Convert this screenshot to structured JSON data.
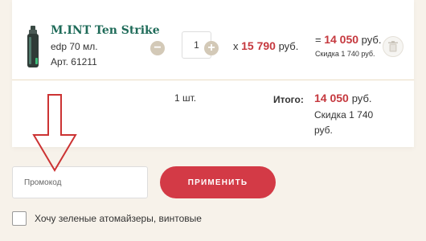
{
  "product": {
    "title": "M.INT Ten Strike",
    "volume": "edp 70 мл.",
    "article_label": "Арт.",
    "article_value": "61211",
    "image_icon": "perfume-bottle-icon"
  },
  "quantity": {
    "value": "1",
    "decrease_icon": "minus-icon",
    "increase_icon": "plus-icon",
    "decrease_glyph": "−",
    "increase_glyph": "+"
  },
  "pricing": {
    "multiplier": "x",
    "unit_price": "15 790",
    "equals": "=",
    "line_total": "14 050",
    "currency": "руб.",
    "discount_text": "Скидка 1 740 руб."
  },
  "summary": {
    "count": "1 шт.",
    "total_label": "Итого:",
    "total_value": "14 050",
    "currency": "руб.",
    "discount_text": "Скидка 1 740 руб."
  },
  "promo": {
    "placeholder": "Промокод",
    "apply_label": "ПРИМЕНИТЬ"
  },
  "option": {
    "checked": false,
    "label": "Хочу зеленые атомайзеры, винтовые"
  },
  "colors": {
    "background": "#f7f2ea",
    "title_green": "#1f6b59",
    "price_red": "#c5383e",
    "button_red": "#d33a46",
    "divider": "#e9dcc4",
    "qty_button": "#d3c9b7",
    "annotation_arrow": "#cc3333"
  }
}
